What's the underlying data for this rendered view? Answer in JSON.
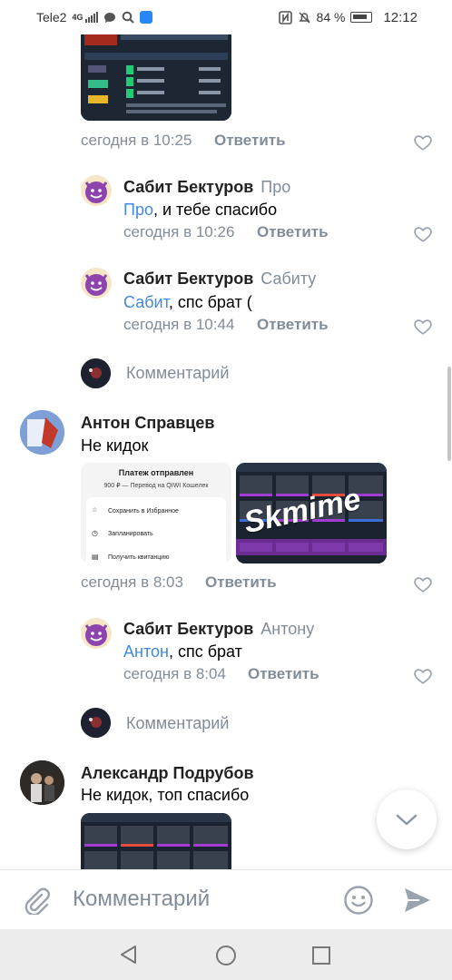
{
  "status_bar": {
    "carrier": "Tele2",
    "network": "4G",
    "battery_percent": "84 %",
    "time": "12:12"
  },
  "thread": {
    "top_item": {
      "time": "сегодня в 10:25",
      "reply_label": "Ответить"
    },
    "replies_1": [
      {
        "name": "Сабит Бектуров",
        "reply_to": "Про",
        "mention": "Про",
        "text": ", и тебе спасибо",
        "time": "сегодня в 10:26",
        "reply_label": "Ответить"
      },
      {
        "name": "Сабит Бектуров",
        "reply_to": "Сабиту",
        "mention": "Сабит",
        "text": ", спс брат (",
        "time": "сегодня в 10:44",
        "reply_label": "Ответить"
      }
    ],
    "comment_prompt_1": "Комментарий",
    "comment_2": {
      "name": "Антон Справцев",
      "text": "Не кидок",
      "time": "сегодня в 8:03",
      "reply_label": "Ответить",
      "receipt": {
        "title": "Платеж отправлен",
        "subtitle": "900 ₽ — Перевод на QIWI Кошелек",
        "menu": [
          "Сохранить в Избранное",
          "Запланировать",
          "Получить квитанцию"
        ]
      },
      "watermark": "Skmime"
    },
    "reply_2": {
      "name": "Сабит Бектуров",
      "reply_to": "Антону",
      "mention": "Антон",
      "text": ", спс брат",
      "time": "сегодня в 8:04",
      "reply_label": "Ответить"
    },
    "comment_prompt_2": "Комментарий",
    "comment_3": {
      "name": "Александр Подрубов",
      "text": "Не кидок, топ спасибо"
    }
  },
  "input": {
    "placeholder": "Комментарий"
  },
  "icons": {
    "attach": "paperclip-icon",
    "emoji": "smile-icon",
    "send": "send-icon",
    "like": "heart-outline-icon",
    "scroll_down": "chevron-down-icon",
    "nav_back": "triangle-back-icon",
    "nav_home": "circle-home-icon",
    "nav_recent": "square-recent-icon"
  },
  "colors": {
    "accent": "#3f8ae0",
    "secondary_text": "#818c99",
    "nav_bg": "#ececec"
  }
}
